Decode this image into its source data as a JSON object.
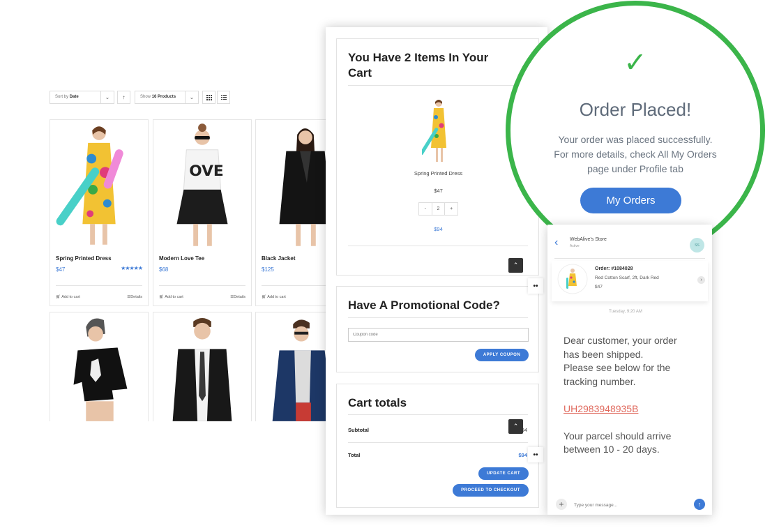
{
  "shop": {
    "sort": {
      "prefix": "Sort by",
      "value": "Date"
    },
    "show": {
      "prefix": "Show",
      "value": "16 Products"
    },
    "sort_dir_icon": "↑",
    "products": [
      {
        "name": "Spring Printed Dress",
        "price": "$47",
        "rating": 5,
        "add_to_cart": "Add to cart",
        "details": "Details"
      },
      {
        "name": "Modern Love Tee",
        "price": "$68",
        "add_to_cart": "Add to cart",
        "details": "Details"
      },
      {
        "name": "Black Jacket",
        "price": "$125",
        "add_to_cart": "Add to cart"
      }
    ]
  },
  "cart": {
    "title_line1": "You Have 2 Items In Your",
    "title_line2": "Cart",
    "item": {
      "name": "Spring Printed Dress",
      "price": "$47",
      "qty": "2",
      "minus": "-",
      "plus": "+",
      "total": "$94"
    },
    "promo": {
      "title": "Have A Promotional Code?",
      "placeholder": "Coupon code",
      "apply": "APPLY COUPON"
    },
    "totals": {
      "title": "Cart totals",
      "subtotal_label": "Subtotal",
      "subtotal_value": "$94",
      "total_label": "Total",
      "total_value": "$94",
      "update": "UPDATE CART",
      "checkout": "PROCEED TO CHECKOUT"
    },
    "up_icon": "⌃",
    "dots_icon": "••"
  },
  "order": {
    "check": "✓",
    "title": "Order Placed!",
    "line1": "Your order was placed successfully.",
    "line2": "For more details, check All My Orders",
    "line3": "page under Profile tab",
    "button": "My Orders"
  },
  "chat": {
    "store": "WebAlive's Store",
    "status": "Active",
    "avatar": "SS",
    "order_no": "Order: #1084028",
    "order_desc": "Red Cotton Scarf, 2ft, Dark Red",
    "order_price": "$47",
    "timestamp": "Tuesday, 9:20 AM",
    "message": {
      "l1": "Dear customer, your order",
      "l2": "has been shipped.",
      "l3": "Please see below for the",
      "l4": "tracking number.",
      "tracking": "UH2983948935B",
      "l5": "Your parcel should arrive",
      "l6": "between 10 - 20 days."
    },
    "placeholder": "Type your message..."
  },
  "colors": {
    "accent": "#3d7ad6",
    "success": "#3bb54a",
    "tracking": "#e06a5e"
  }
}
